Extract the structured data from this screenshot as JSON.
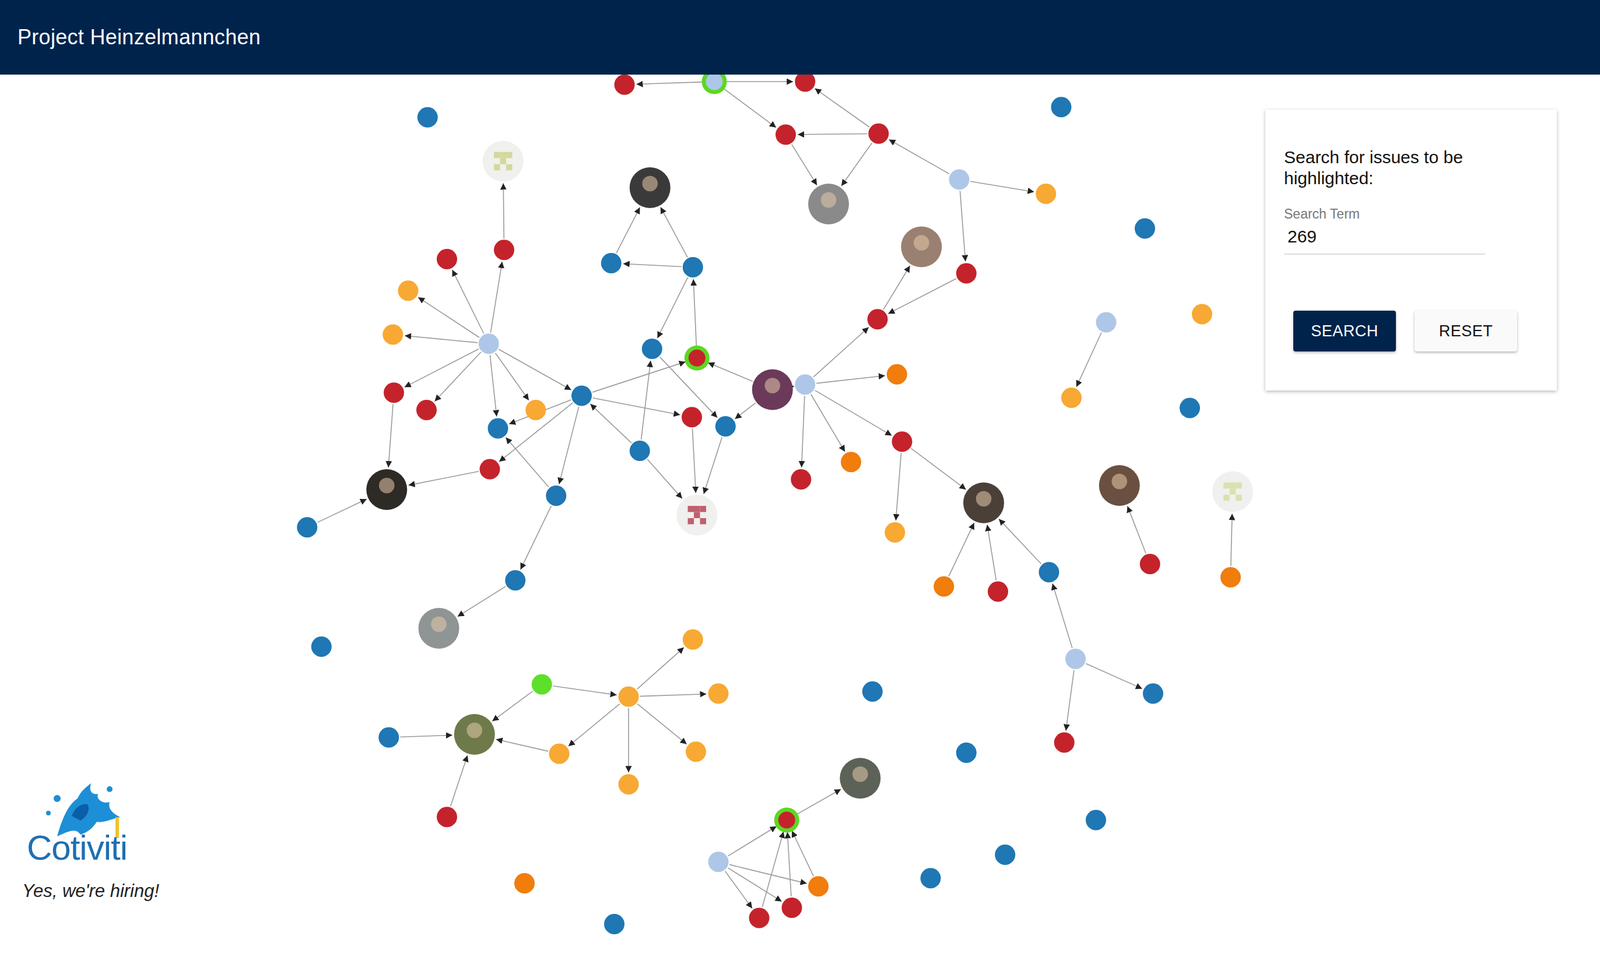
{
  "header": {
    "title": "Project Heinzelmannchen"
  },
  "search": {
    "heading": "Search for issues to be highlighted:",
    "label": "Search Term",
    "value": "269"
  },
  "buttons": [
    {
      "label": "SEARCH",
      "kind": "primary"
    },
    {
      "label": "RESET",
      "kind": "secondary"
    }
  ],
  "brand": {
    "logo": "Cotiviti",
    "tagline": "Yes, we're hiring!"
  },
  "graph": {
    "nodes": [
      {
        "kind": "issue",
        "color": "#aec7e8",
        "highlighted": true
      },
      {
        "kind": "issue",
        "color": "#c4232b",
        "highlighted": false
      },
      {
        "kind": "issue",
        "color": "#c4232b",
        "highlighted": false
      },
      {
        "kind": "issue",
        "color": "#c4232b",
        "highlighted": false
      },
      {
        "kind": "issue",
        "color": "#c4232b",
        "highlighted": false
      },
      {
        "kind": "photo",
        "color": "#8a8a8a",
        "highlighted": false
      },
      {
        "kind": "issue",
        "color": "#aec7e8",
        "highlighted": false
      },
      {
        "kind": "issue",
        "color": "#f7a933",
        "highlighted": false
      },
      {
        "kind": "issue",
        "color": "#c4232b",
        "highlighted": false
      },
      {
        "kind": "photo",
        "color": "#9a8070",
        "highlighted": false
      },
      {
        "kind": "issue",
        "color": "#c4232b",
        "highlighted": false
      },
      {
        "kind": "photo",
        "color": "#3a3a3a",
        "highlighted": false
      },
      {
        "kind": "issue",
        "color": "#1f77b4",
        "highlighted": false
      },
      {
        "kind": "issue",
        "color": "#1f77b4",
        "highlighted": false
      },
      {
        "kind": "issue",
        "color": "#1f77b4",
        "highlighted": false
      },
      {
        "kind": "issue",
        "color": "#c4232b",
        "highlighted": true
      },
      {
        "kind": "photo",
        "color": "#6b3a5a",
        "highlighted": false
      },
      {
        "kind": "issue",
        "color": "#aec7e8",
        "highlighted": false
      },
      {
        "kind": "issue",
        "color": "#f07d0c",
        "highlighted": false
      },
      {
        "kind": "issue",
        "color": "#c4232b",
        "highlighted": false
      },
      {
        "kind": "issue",
        "color": "#f07d0c",
        "highlighted": false
      },
      {
        "kind": "issue",
        "color": "#c4232b",
        "highlighted": false
      },
      {
        "kind": "issue",
        "color": "#f7a933",
        "highlighted": false
      },
      {
        "kind": "photo",
        "color": "#4a4038",
        "highlighted": false
      },
      {
        "kind": "issue",
        "color": "#f07d0c",
        "highlighted": false
      },
      {
        "kind": "issue",
        "color": "#c4232b",
        "highlighted": false
      },
      {
        "kind": "issue",
        "color": "#1f77b4",
        "highlighted": false
      },
      {
        "kind": "issue",
        "color": "#aec7e8",
        "highlighted": false
      },
      {
        "kind": "issue",
        "color": "#1f77b4",
        "highlighted": false
      },
      {
        "kind": "issue",
        "color": "#c4232b",
        "highlighted": false
      },
      {
        "kind": "issue",
        "color": "#c4232b",
        "highlighted": false
      },
      {
        "kind": "issue",
        "color": "#1f77b4",
        "highlighted": false
      },
      {
        "kind": "issue",
        "color": "#1f77b4",
        "highlighted": false
      },
      {
        "kind": "identicon",
        "color": "#c0606e",
        "highlighted": false
      },
      {
        "kind": "issue",
        "color": "#1f77b4",
        "highlighted": false
      },
      {
        "kind": "issue",
        "color": "#aec7e8",
        "highlighted": false
      },
      {
        "kind": "issue",
        "color": "#f7a933",
        "highlighted": false
      },
      {
        "kind": "issue",
        "color": "#f7a933",
        "highlighted": false
      },
      {
        "kind": "issue",
        "color": "#c4232b",
        "highlighted": false
      },
      {
        "kind": "issue",
        "color": "#c4232b",
        "highlighted": false
      },
      {
        "kind": "identicon",
        "color": "#d4d89a",
        "highlighted": false
      },
      {
        "kind": "issue",
        "color": "#c4232b",
        "highlighted": false
      },
      {
        "kind": "issue",
        "color": "#c4232b",
        "highlighted": false
      },
      {
        "kind": "issue",
        "color": "#f7a933",
        "highlighted": false
      },
      {
        "kind": "issue",
        "color": "#1f77b4",
        "highlighted": false
      },
      {
        "kind": "issue",
        "color": "#c4232b",
        "highlighted": false
      },
      {
        "kind": "photo",
        "color": "#2e2a26",
        "highlighted": false
      },
      {
        "kind": "issue",
        "color": "#1f77b4",
        "highlighted": false
      },
      {
        "kind": "issue",
        "color": "#1f77b4",
        "highlighted": false
      },
      {
        "kind": "issue",
        "color": "#1f77b4",
        "highlighted": false
      },
      {
        "kind": "photo",
        "color": "#8f9494",
        "highlighted": false
      },
      {
        "kind": "issue",
        "color": "#1f77b4",
        "highlighted": false
      },
      {
        "kind": "issue",
        "color": "#1f77b4",
        "highlighted": false
      },
      {
        "kind": "issue",
        "color": "#1f77b4",
        "highlighted": false
      },
      {
        "kind": "issue",
        "color": "#aec7e8",
        "highlighted": false
      },
      {
        "kind": "issue",
        "color": "#f7a933",
        "highlighted": false
      },
      {
        "kind": "issue",
        "color": "#f7a933",
        "highlighted": false
      },
      {
        "kind": "issue",
        "color": "#1f77b4",
        "highlighted": false
      },
      {
        "kind": "photo",
        "color": "#6a5040",
        "highlighted": false
      },
      {
        "kind": "issue",
        "color": "#c4232b",
        "highlighted": false
      },
      {
        "kind": "identicon",
        "color": "#d8e2b0",
        "highlighted": false
      },
      {
        "kind": "issue",
        "color": "#f07d0c",
        "highlighted": false
      },
      {
        "kind": "issue",
        "color": "#1f77b4",
        "highlighted": false
      },
      {
        "kind": "issue",
        "color": "#5ee02a",
        "highlighted": false
      },
      {
        "kind": "issue",
        "color": "#f7a933",
        "highlighted": false
      },
      {
        "kind": "issue",
        "color": "#f7a933",
        "highlighted": false
      },
      {
        "kind": "issue",
        "color": "#f7a933",
        "highlighted": false
      },
      {
        "kind": "issue",
        "color": "#f7a933",
        "highlighted": false
      },
      {
        "kind": "issue",
        "color": "#f7a933",
        "highlighted": false
      },
      {
        "kind": "issue",
        "color": "#f7a933",
        "highlighted": false
      },
      {
        "kind": "photo",
        "color": "#6e7a4a",
        "highlighted": false
      },
      {
        "kind": "issue",
        "color": "#1f77b4",
        "highlighted": false
      },
      {
        "kind": "issue",
        "color": "#c4232b",
        "highlighted": false
      },
      {
        "kind": "issue",
        "color": "#1f77b4",
        "highlighted": false
      },
      {
        "kind": "issue",
        "color": "#1f77b4",
        "highlighted": false
      },
      {
        "kind": "photo",
        "color": "#5c6258",
        "highlighted": false
      },
      {
        "kind": "issue",
        "color": "#c4232b",
        "highlighted": true
      },
      {
        "kind": "issue",
        "color": "#aec7e8",
        "highlighted": false
      },
      {
        "kind": "issue",
        "color": "#c4232b",
        "highlighted": false
      },
      {
        "kind": "issue",
        "color": "#c4232b",
        "highlighted": false
      },
      {
        "kind": "issue",
        "color": "#f07d0c",
        "highlighted": false
      },
      {
        "kind": "issue",
        "color": "#f07d0c",
        "highlighted": false
      },
      {
        "kind": "issue",
        "color": "#1f77b4",
        "highlighted": false
      },
      {
        "kind": "issue",
        "color": "#1f77b4",
        "highlighted": false
      },
      {
        "kind": "issue",
        "color": "#1f77b4",
        "highlighted": false
      },
      {
        "kind": "issue",
        "color": "#1f77b4",
        "highlighted": false
      }
    ],
    "edges": [
      [
        0,
        1
      ],
      [
        0,
        2
      ],
      [
        0,
        3
      ],
      [
        4,
        3
      ],
      [
        4,
        2
      ],
      [
        3,
        5
      ],
      [
        4,
        5
      ],
      [
        6,
        4
      ],
      [
        6,
        7
      ],
      [
        6,
        8
      ],
      [
        8,
        10
      ],
      [
        10,
        9
      ],
      [
        17,
        10
      ],
      [
        13,
        12
      ],
      [
        12,
        11
      ],
      [
        13,
        11
      ],
      [
        13,
        14
      ],
      [
        15,
        13
      ],
      [
        16,
        15
      ],
      [
        32,
        14
      ],
      [
        34,
        15
      ],
      [
        17,
        16
      ],
      [
        16,
        31
      ],
      [
        17,
        18
      ],
      [
        17,
        19
      ],
      [
        17,
        20
      ],
      [
        17,
        21
      ],
      [
        21,
        22
      ],
      [
        21,
        23
      ],
      [
        24,
        23
      ],
      [
        25,
        23
      ],
      [
        26,
        23
      ],
      [
        27,
        26
      ],
      [
        27,
        28
      ],
      [
        27,
        29
      ],
      [
        34,
        30
      ],
      [
        30,
        33
      ],
      [
        31,
        33
      ],
      [
        32,
        33
      ],
      [
        14,
        31
      ],
      [
        32,
        34
      ],
      [
        34,
        44
      ],
      [
        34,
        48
      ],
      [
        34,
        45
      ],
      [
        35,
        34
      ],
      [
        35,
        36
      ],
      [
        35,
        37
      ],
      [
        35,
        38
      ],
      [
        35,
        39
      ],
      [
        35,
        41
      ],
      [
        35,
        42
      ],
      [
        35,
        43
      ],
      [
        35,
        44
      ],
      [
        39,
        40
      ],
      [
        41,
        46
      ],
      [
        45,
        46
      ],
      [
        47,
        46
      ],
      [
        48,
        44
      ],
      [
        48,
        49
      ],
      [
        49,
        50
      ],
      [
        54,
        55
      ],
      [
        59,
        58
      ],
      [
        61,
        60
      ],
      [
        63,
        70
      ],
      [
        63,
        64
      ],
      [
        64,
        65
      ],
      [
        64,
        66
      ],
      [
        64,
        67
      ],
      [
        64,
        68
      ],
      [
        64,
        69
      ],
      [
        69,
        70
      ],
      [
        71,
        70
      ],
      [
        72,
        70
      ],
      [
        76,
        75
      ],
      [
        77,
        76
      ],
      [
        77,
        78
      ],
      [
        77,
        79
      ],
      [
        77,
        80
      ],
      [
        78,
        76
      ],
      [
        79,
        76
      ],
      [
        80,
        76
      ]
    ]
  }
}
